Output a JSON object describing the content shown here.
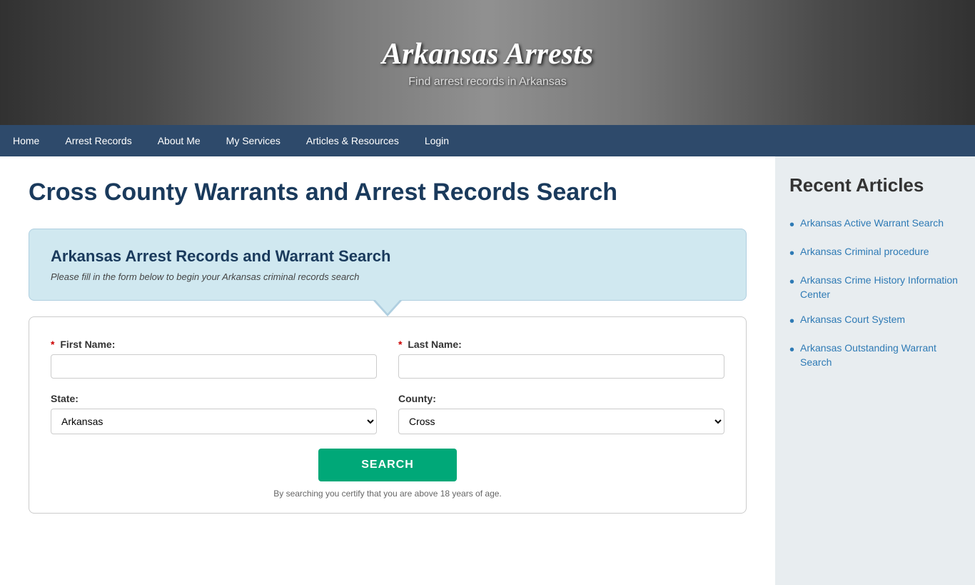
{
  "site": {
    "title": "Arkansas Arrests",
    "subtitle": "Find arrest records in Arkansas"
  },
  "nav": {
    "items": [
      {
        "label": "Home",
        "active": false
      },
      {
        "label": "Arrest Records",
        "active": false
      },
      {
        "label": "About Me",
        "active": false
      },
      {
        "label": "My Services",
        "active": false
      },
      {
        "label": "Articles & Resources",
        "active": false
      },
      {
        "label": "Login",
        "active": false
      }
    ]
  },
  "main": {
    "page_heading": "Cross County Warrants and Arrest Records Search",
    "form_card_title": "Arkansas Arrest Records and Warrant Search",
    "form_card_subtitle": "Please fill in the form below to begin your Arkansas criminal records search",
    "form": {
      "first_name_label": "First Name:",
      "last_name_label": "Last Name:",
      "state_label": "State:",
      "county_label": "County:",
      "state_value": "Arkansas",
      "county_value": "Cross",
      "search_button": "SEARCH",
      "form_note": "By searching you certify that you are above 18 years of age."
    }
  },
  "sidebar": {
    "title": "Recent Articles",
    "articles": [
      {
        "label": "Arkansas Active Warrant Search"
      },
      {
        "label": "Arkansas Criminal procedure"
      },
      {
        "label": "Arkansas Crime History Information Center"
      },
      {
        "label": "Arkansas Court System"
      },
      {
        "label": "Arkansas Outstanding Warrant Search"
      }
    ]
  }
}
